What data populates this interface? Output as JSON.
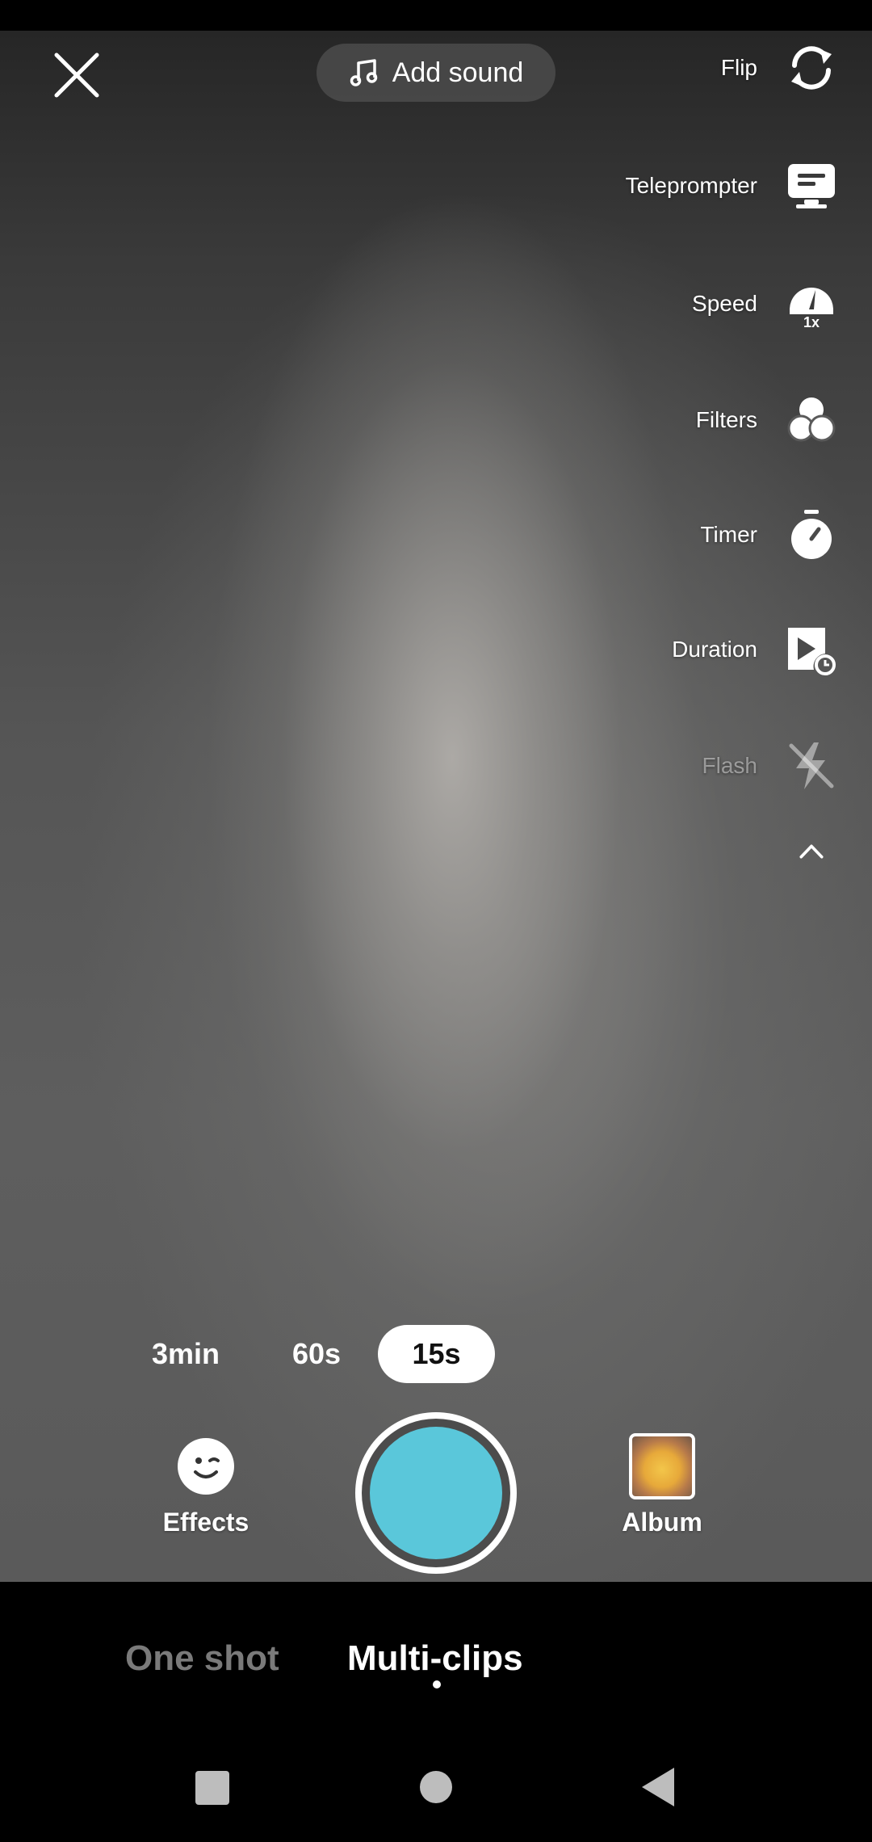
{
  "top_bar": {
    "add_sound_label": "Add sound",
    "close_icon": "close-icon",
    "music_icon": "music-note-icon"
  },
  "side_tools": {
    "flip": {
      "label": "Flip",
      "icon": "flip-camera-icon"
    },
    "teleprompter": {
      "label": "Teleprompter",
      "icon": "teleprompter-icon"
    },
    "speed": {
      "label": "Speed",
      "icon": "speed-icon",
      "value": "1x"
    },
    "filters": {
      "label": "Filters",
      "icon": "filters-icon"
    },
    "timer": {
      "label": "Timer",
      "icon": "timer-icon"
    },
    "duration": {
      "label": "Duration",
      "icon": "duration-icon"
    },
    "flash": {
      "label": "Flash",
      "icon": "flash-off-icon",
      "enabled": false
    },
    "collapse_icon": "chevron-up-icon"
  },
  "durations": {
    "options": [
      "3min",
      "60s",
      "15s"
    ],
    "selected": "15s"
  },
  "bottom_controls": {
    "effects_label": "Effects",
    "album_label": "Album",
    "record_color": "#5ac7da"
  },
  "modes": {
    "items": [
      "One shot",
      "Multi-clips"
    ],
    "selected": "Multi-clips"
  },
  "system_nav": {
    "recents_icon": "square-icon",
    "home_icon": "circle-icon",
    "back_icon": "triangle-back-icon"
  }
}
